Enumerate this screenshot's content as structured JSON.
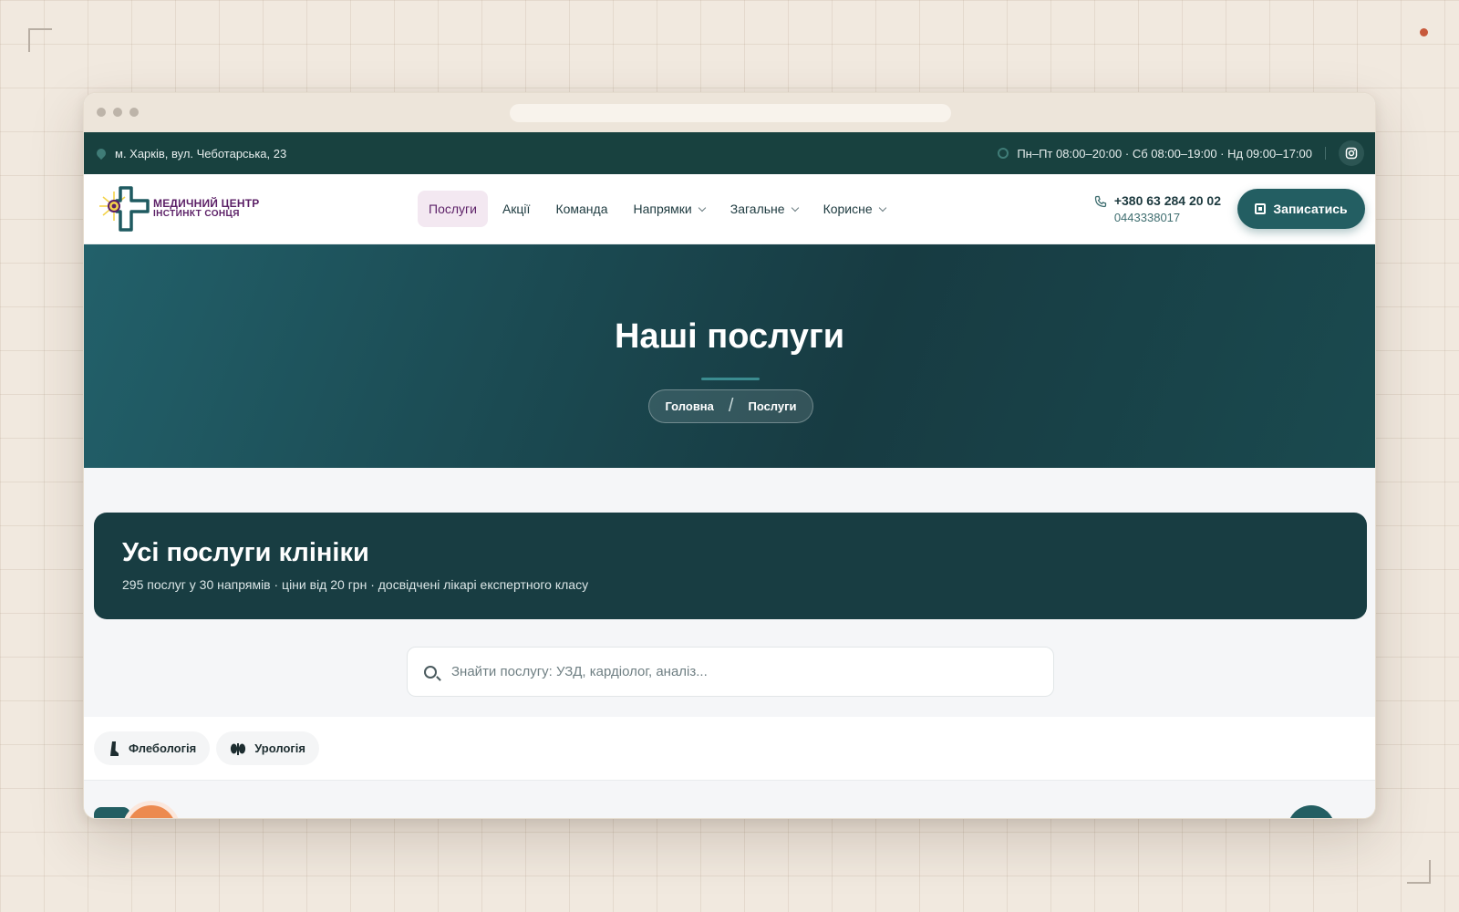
{
  "topbar": {
    "address": "м. Харків, вул. Чеботарська, 23",
    "hours": "Пн–Пт 08:00–20:00 · Сб 08:00–19:00 · Нд 09:00–17:00",
    "instagram_icon": "instagram-icon"
  },
  "logo": {
    "line1": "МЕДИЧНИЙ ЦЕНТР",
    "line2": "ІНСТИНКТ СОНЦЯ"
  },
  "nav": {
    "items": [
      {
        "label": "Послуги",
        "active": true,
        "dropdown": false
      },
      {
        "label": "Акції",
        "active": false,
        "dropdown": false
      },
      {
        "label": "Команда",
        "active": false,
        "dropdown": false
      },
      {
        "label": "Напрямки",
        "active": false,
        "dropdown": true
      },
      {
        "label": "Загальне",
        "active": false,
        "dropdown": true
      },
      {
        "label": "Корисне",
        "active": false,
        "dropdown": true
      }
    ]
  },
  "contacts": {
    "phone1": "+380 63 284 20 02",
    "phone2": "0443338017"
  },
  "book_button": {
    "label": "Записатись"
  },
  "hero": {
    "title": "Наші послуги",
    "breadcrumbs": [
      "Головна",
      "Послуги"
    ]
  },
  "banner": {
    "title": "Усі послуги клініки",
    "subtitle": "295 послуг у 30 напрямів · ціни від 20 грн · досвідчені лікарі експертного класу"
  },
  "search": {
    "placeholder": "Знайти послугу: УЗД, кардіолог, аналіз..."
  },
  "filters": [
    {
      "label": "Флебологія",
      "icon": "leg-icon"
    },
    {
      "label": "Урологія",
      "icon": "kidneys-icon"
    }
  ],
  "colors": {
    "primary": "#18413f",
    "accent": "#235e62",
    "brand_purple": "#5b1f66",
    "background": "#f1e9df"
  }
}
